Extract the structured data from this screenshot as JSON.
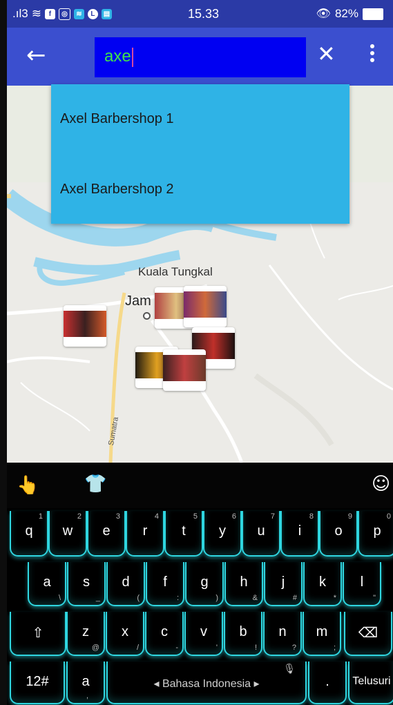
{
  "status": {
    "signal": ".ıl3",
    "time": "15.33",
    "battery": "82%"
  },
  "appbar": {
    "search_value": "axe",
    "search_placeholder": ""
  },
  "suggestions": [
    "Axel Barbershop 1",
    "Axel Barbershop 2"
  ],
  "map": {
    "place_label": "Kuala Tungkal",
    "partial_label": "Jam",
    "road_label": "Sumatra"
  },
  "keyboard": {
    "row1": [
      {
        "k": "q",
        "n": "1"
      },
      {
        "k": "w",
        "n": "2"
      },
      {
        "k": "e",
        "n": "3"
      },
      {
        "k": "r",
        "n": "4"
      },
      {
        "k": "t",
        "n": "5"
      },
      {
        "k": "y",
        "n": "6"
      },
      {
        "k": "u",
        "n": "7"
      },
      {
        "k": "i",
        "n": "8"
      },
      {
        "k": "o",
        "n": "9"
      },
      {
        "k": "p",
        "n": "0"
      }
    ],
    "row2": [
      {
        "k": "a",
        "s": "\\"
      },
      {
        "k": "s",
        "s": "_"
      },
      {
        "k": "d",
        "s": "("
      },
      {
        "k": "f",
        "s": ":"
      },
      {
        "k": "g",
        "s": ")"
      },
      {
        "k": "h",
        "s": "&"
      },
      {
        "k": "j",
        "s": "#"
      },
      {
        "k": "k",
        "s": "*"
      },
      {
        "k": "l",
        "s": "\""
      }
    ],
    "row3": [
      {
        "k": "z",
        "s": "@"
      },
      {
        "k": "x",
        "s": "/"
      },
      {
        "k": "c",
        "s": "-"
      },
      {
        "k": "v",
        "s": "'"
      },
      {
        "k": "b",
        "s": "!"
      },
      {
        "k": "n",
        "s": "?"
      },
      {
        "k": "m",
        "s": ";"
      }
    ],
    "numbers_key": "12#",
    "comma_main": "a",
    "comma_sub": ",",
    "space_label": "◂ Bahasa Indonesia ▸",
    "period_key": ".",
    "search_key": "Telusuri"
  },
  "colors": {
    "accent": "#3b4fcf",
    "status": "#2b3aa6",
    "search_bg": "#0000f2",
    "dropdown": "#2fb3e6",
    "key_glow": "#2fd6e0"
  }
}
